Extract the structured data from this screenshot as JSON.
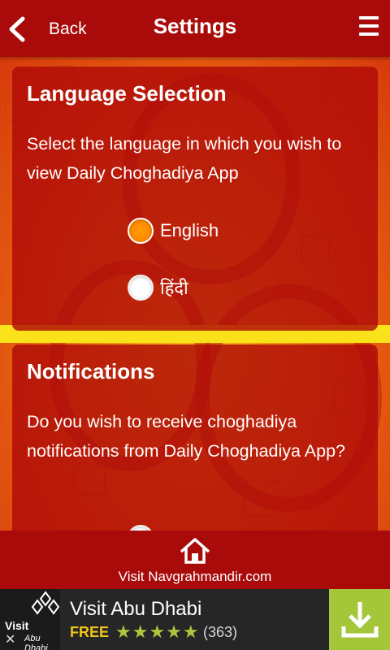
{
  "header": {
    "back_label": "Back",
    "title": "Settings"
  },
  "language": {
    "title": "Language Selection",
    "description": "Select the language in which you wish to view Daily Choghadiya App",
    "options": [
      {
        "label": "English",
        "selected": true
      },
      {
        "label": "हिंदी",
        "selected": false
      }
    ]
  },
  "notifications": {
    "title": "Notifications",
    "description": "Do you wish to receive choghadiya notifications from Daily Choghadiya App?"
  },
  "footer": {
    "visit_label": "Visit Navgrahmandir.com",
    "icon": "home-icon"
  },
  "ad": {
    "logo_text": "Visit",
    "logo_sub": "Abu Dhabi",
    "title": "Visit Abu Dhabi",
    "price": "FREE",
    "rating": 4.5,
    "rating_stars": "★★★★★",
    "review_count": "(363)",
    "close_symbol": "✕",
    "download_icon": "download-icon"
  },
  "colors": {
    "header_bg": "#a90a0a",
    "radio_selected": "#ff8a00",
    "ad_download_bg": "#a4c639",
    "ad_free": "#f0c419"
  }
}
